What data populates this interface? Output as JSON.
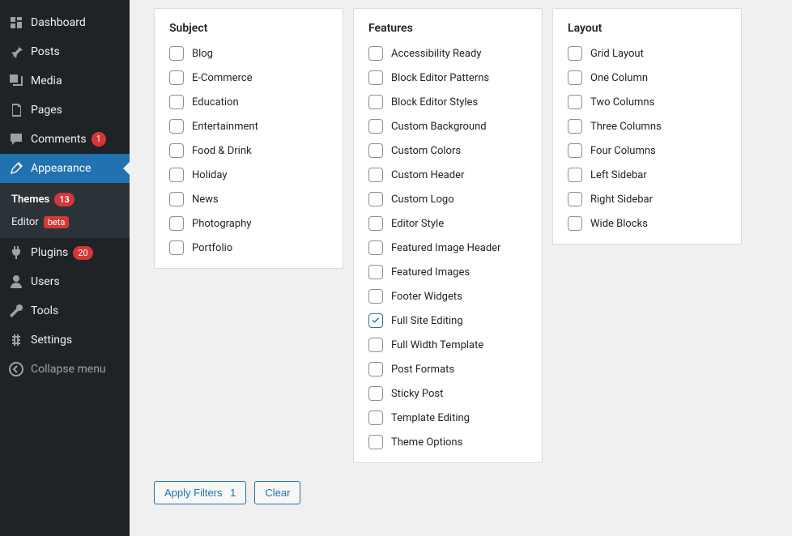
{
  "sidebar": {
    "items": [
      {
        "label": "Dashboard",
        "icon": "dashboard"
      },
      {
        "label": "Posts",
        "icon": "posts"
      },
      {
        "label": "Media",
        "icon": "media"
      },
      {
        "label": "Pages",
        "icon": "pages"
      },
      {
        "label": "Comments",
        "icon": "comments",
        "badge": "1"
      },
      {
        "label": "Appearance",
        "icon": "appearance",
        "active": true
      },
      {
        "label": "Plugins",
        "icon": "plugins",
        "badge": "20"
      },
      {
        "label": "Users",
        "icon": "users"
      },
      {
        "label": "Tools",
        "icon": "tools"
      },
      {
        "label": "Settings",
        "icon": "settings"
      }
    ],
    "submenu": [
      {
        "label": "Themes",
        "badge": "13",
        "current": true
      },
      {
        "label": "Editor",
        "beta": "beta"
      }
    ],
    "collapse": "Collapse menu"
  },
  "filters": {
    "subject": {
      "title": "Subject",
      "items": [
        {
          "label": "Blog",
          "checked": false
        },
        {
          "label": "E-Commerce",
          "checked": false
        },
        {
          "label": "Education",
          "checked": false
        },
        {
          "label": "Entertainment",
          "checked": false
        },
        {
          "label": "Food & Drink",
          "checked": false
        },
        {
          "label": "Holiday",
          "checked": false
        },
        {
          "label": "News",
          "checked": false
        },
        {
          "label": "Photography",
          "checked": false
        },
        {
          "label": "Portfolio",
          "checked": false
        }
      ]
    },
    "features": {
      "title": "Features",
      "items": [
        {
          "label": "Accessibility Ready",
          "checked": false
        },
        {
          "label": "Block Editor Patterns",
          "checked": false
        },
        {
          "label": "Block Editor Styles",
          "checked": false
        },
        {
          "label": "Custom Background",
          "checked": false
        },
        {
          "label": "Custom Colors",
          "checked": false
        },
        {
          "label": "Custom Header",
          "checked": false
        },
        {
          "label": "Custom Logo",
          "checked": false
        },
        {
          "label": "Editor Style",
          "checked": false
        },
        {
          "label": "Featured Image Header",
          "checked": false
        },
        {
          "label": "Featured Images",
          "checked": false
        },
        {
          "label": "Footer Widgets",
          "checked": false
        },
        {
          "label": "Full Site Editing",
          "checked": true
        },
        {
          "label": "Full Width Template",
          "checked": false
        },
        {
          "label": "Post Formats",
          "checked": false
        },
        {
          "label": "Sticky Post",
          "checked": false
        },
        {
          "label": "Template Editing",
          "checked": false
        },
        {
          "label": "Theme Options",
          "checked": false
        }
      ]
    },
    "layout": {
      "title": "Layout",
      "items": [
        {
          "label": "Grid Layout",
          "checked": false
        },
        {
          "label": "One Column",
          "checked": false
        },
        {
          "label": "Two Columns",
          "checked": false
        },
        {
          "label": "Three Columns",
          "checked": false
        },
        {
          "label": "Four Columns",
          "checked": false
        },
        {
          "label": "Left Sidebar",
          "checked": false
        },
        {
          "label": "Right Sidebar",
          "checked": false
        },
        {
          "label": "Wide Blocks",
          "checked": false
        }
      ]
    }
  },
  "actions": {
    "apply_label": "Apply Filters",
    "apply_count": "1",
    "clear_label": "Clear"
  }
}
